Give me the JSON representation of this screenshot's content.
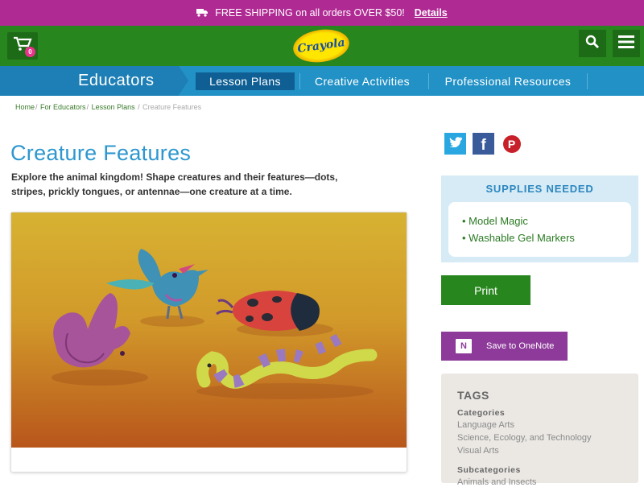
{
  "promo": {
    "text": "FREE SHIPPING on all orders OVER $50!",
    "link": "Details",
    "icon": "truck-icon"
  },
  "header": {
    "cart_count": "0",
    "logo_text": "Crayola",
    "colors": {
      "promo": "#b02a93",
      "header": "#27861d",
      "nav": "#2191c6"
    }
  },
  "nav": {
    "section": "Educators",
    "tabs": [
      "Lesson Plans",
      "Creative Activities",
      "Professional Resources"
    ],
    "active_tab": "Lesson Plans"
  },
  "breadcrumb": {
    "items": [
      "Home",
      "For Educators",
      "Lesson Plans"
    ],
    "current": "Creature Features"
  },
  "article": {
    "title": "Creature Features",
    "intro": "Explore the animal kingdom! Shape creatures and their features—dots, stripes, prickly tongues, or antennae—one creature at a time."
  },
  "sidebar": {
    "supplies_title": "SUPPLIES NEEDED",
    "supplies": [
      "Model Magic",
      "Washable Gel Markers"
    ],
    "print_label": "Print",
    "onenote_label": "Save to OneNote",
    "tags_title": "TAGS",
    "categories_label": "Categories",
    "categories": [
      "Language Arts",
      "Science, Ecology, and Technology",
      "Visual Arts"
    ],
    "subcategories_label": "Subcategories",
    "subcategories": [
      "Animals and Insects"
    ]
  }
}
